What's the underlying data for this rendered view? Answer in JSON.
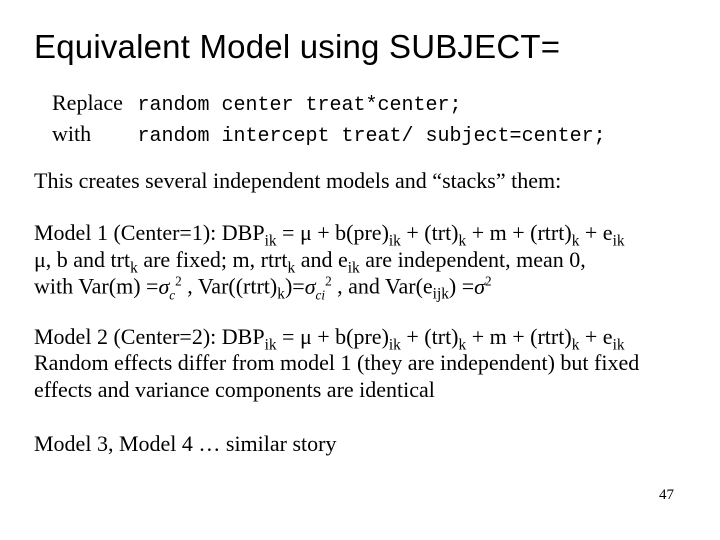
{
  "title": "Equivalent Model using SUBJECT=",
  "replace": {
    "line1_label": "Replace",
    "line1_code": "random center treat*center;",
    "line2_label": "with",
    "line2_code": "random intercept treat/ subject=center;"
  },
  "para_intro": "This creates several independent models and “stacks” them:",
  "model1": {
    "line1_prefix": "Model 1 (Center=1):  DBP",
    "sub_ik": "ik",
    "eq1": " = μ + b(pre)",
    "eq2": " + (trt)",
    "sub_k": "k",
    "eq3": " + m + (rtrt)",
    "eq4": " + e",
    "line2_a": "μ, b and trt",
    "line2_b": " are fixed; m, rtrt",
    "line2_c": " and e",
    "line2_d": " are independent, mean 0,",
    "line3_a": "with Var(m) =",
    "var_m": "σ",
    "var_m_sub": "c",
    "var_m_sup": "2",
    "line3_b": " , Var((rtrt)",
    "line3_c": ")=",
    "var_r": "σ",
    "var_r_sub": "ci",
    "var_r_sup": "2",
    "line3_d": "  , and Var(e",
    "sub_ijk": "ijk",
    "line3_e": ") =",
    "var_e": "σ",
    "var_e_sup": "2"
  },
  "model2": {
    "line1_prefix": "Model 2 (Center=2): DBP",
    "line2": "Random effects differ from model 1 (they are independent) but fixed",
    "line3": "effects and variance components are identical"
  },
  "model3": "Model 3,  Model 4 … similar story",
  "page": "47"
}
